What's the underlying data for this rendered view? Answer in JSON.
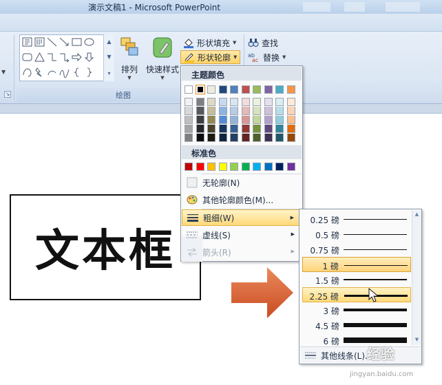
{
  "window": {
    "title": "演示文稿1 - Microsoft PowerPoint"
  },
  "ribbon": {
    "group_drawing_label": "绘图",
    "arrange_label": "排列",
    "quick_styles_label": "快速样式",
    "shape_fill_label": "形状填充",
    "shape_outline_label": "形状轮廓",
    "find_label": "查找",
    "replace_label": "替换"
  },
  "outline_menu": {
    "theme_colors_header": "主题颜色",
    "standard_colors_header": "标准色",
    "theme_top_row": [
      "#ffffff",
      "#000000",
      "#eeece1",
      "#1f497d",
      "#4f81bd",
      "#c0504d",
      "#9bbb59",
      "#8064a2",
      "#4bacc6",
      "#f79646"
    ],
    "theme_shades": [
      [
        "#f2f2f2",
        "#7f7f7f",
        "#ddd9c3",
        "#c6d9f0",
        "#dbe5f1",
        "#f2dcdb",
        "#ebf1dd",
        "#e5e0ec",
        "#dbeef3",
        "#fdeada"
      ],
      [
        "#d8d8d8",
        "#595959",
        "#c4bd97",
        "#8db3e2",
        "#b8cce4",
        "#e5b9b7",
        "#d7e3bc",
        "#ccc1d9",
        "#b7dde8",
        "#fbd5b5"
      ],
      [
        "#bfbfbf",
        "#3f3f3f",
        "#938953",
        "#548dd4",
        "#95b3d7",
        "#d99694",
        "#c3d69b",
        "#b2a2c7",
        "#92cddc",
        "#fac08f"
      ],
      [
        "#a5a5a5",
        "#262626",
        "#494429",
        "#17365d",
        "#366092",
        "#953734",
        "#76923c",
        "#5f497a",
        "#31859b",
        "#e36c09"
      ],
      [
        "#7f7f7f",
        "#0c0c0c",
        "#1d1b10",
        "#0f243e",
        "#244061",
        "#632423",
        "#4f6128",
        "#3f3151",
        "#205867",
        "#974806"
      ]
    ],
    "standard_colors": [
      "#c00000",
      "#ff0000",
      "#ffc000",
      "#ffff00",
      "#92d050",
      "#00b050",
      "#00b0f0",
      "#0070c0",
      "#002060",
      "#7030a0"
    ],
    "items": {
      "no_outline": "无轮廓(N)",
      "more_colors": "其他轮廓颜色(M)...",
      "weight": "粗细(W)",
      "dashes": "虚线(S)",
      "arrows": "箭头(R)"
    }
  },
  "weight_menu": {
    "options": [
      {
        "label": "0.25 磅",
        "pt": 0.25
      },
      {
        "label": "0.5 磅",
        "pt": 0.5
      },
      {
        "label": "0.75 磅",
        "pt": 0.75
      },
      {
        "label": "1 磅",
        "pt": 1
      },
      {
        "label": "1.5 磅",
        "pt": 1.5
      },
      {
        "label": "2.25 磅",
        "pt": 2.25
      },
      {
        "label": "3 磅",
        "pt": 3
      },
      {
        "label": "4.5 磅",
        "pt": 4.5
      },
      {
        "label": "6 磅",
        "pt": 6
      }
    ],
    "selected": "1 磅",
    "hovered": "2.25 磅",
    "more_lines": "其他线条(L)..."
  },
  "slide": {
    "textbox_text": "文本框"
  },
  "accent": {
    "arrow_color": "#e06a3c",
    "hover_color": "#ffd978"
  },
  "watermark": {
    "text": "经验",
    "url": "jingyan.baidu.com"
  }
}
